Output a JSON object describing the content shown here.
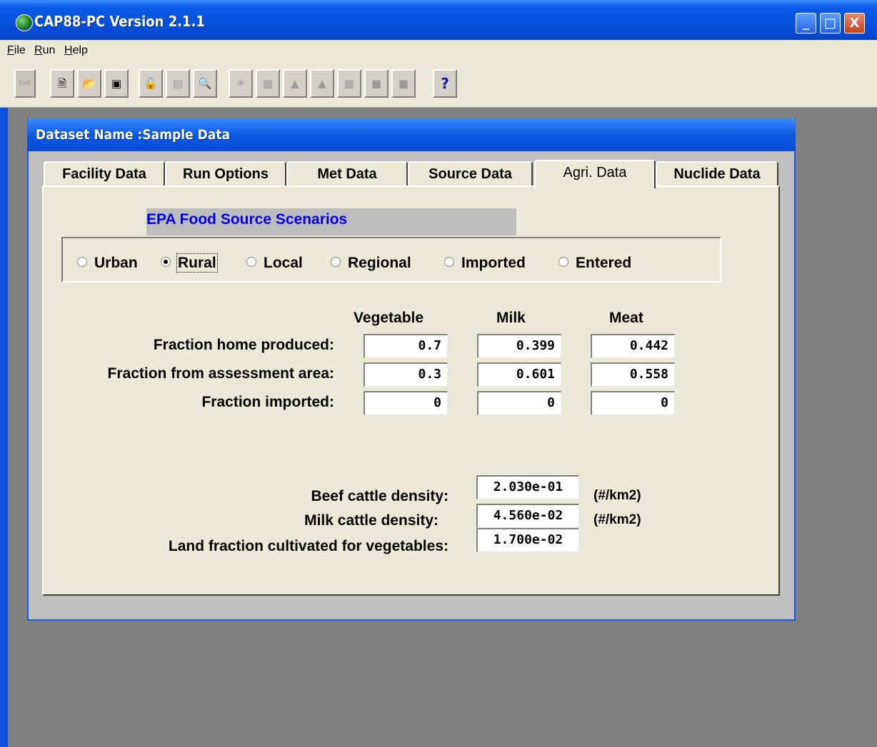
{
  "window": {
    "title": "CAP88-PC Version 2.1.1",
    "controls": [
      "_",
      "□",
      "X"
    ]
  },
  "menu": {
    "items": [
      {
        "label": "File",
        "ul": "F"
      },
      {
        "label": "Run",
        "ul": "R"
      },
      {
        "label": "Help",
        "ul": "H"
      }
    ]
  },
  "toolbar": {
    "exit_label": "Exit",
    "help_label": "?",
    "buttons": [
      "new-document-icon",
      "open-folder-icon",
      "save-disk-icon",
      "open-unlocked-icon",
      "report-icon",
      "print-preview-icon",
      "explode-icon",
      "properties-icon",
      "map-icon",
      "map2-icon",
      "properties2-icon",
      "state-map-icon",
      "state-map2-icon"
    ]
  },
  "dialog": {
    "title": "Dataset Name :Sample Data",
    "tabs": [
      "Facility Data",
      "Run Options",
      "Met Data",
      "Source Data",
      "Agri. Data",
      "Nuclide Data"
    ],
    "active_tab": "Agri. Data",
    "scenario_heading": "EPA Food Source Scenarios",
    "scenarios": [
      "Urban",
      "Rural",
      "Local",
      "Regional",
      "Imported",
      "Entered"
    ],
    "selected_scenario": "Rural",
    "columns": [
      "Vegetable",
      "Milk",
      "Meat"
    ],
    "rows": [
      {
        "label": "Fraction home produced:",
        "values": [
          "0.7",
          "0.399",
          "0.442"
        ]
      },
      {
        "label": "Fraction from assessment area:",
        "values": [
          "0.3",
          "0.601",
          "0.558"
        ]
      },
      {
        "label": "Fraction imported:",
        "values": [
          "0",
          "0",
          "0"
        ]
      }
    ],
    "densities": [
      {
        "label": "Beef cattle density:",
        "value": "2.030e-01",
        "unit": "(#/km2)"
      },
      {
        "label": "Milk cattle density:",
        "value": "4.560e-02",
        "unit": "(#/km2)"
      },
      {
        "label": "Land fraction cultivated for vegetables:",
        "value": "1.700e-02",
        "unit": ""
      }
    ]
  }
}
